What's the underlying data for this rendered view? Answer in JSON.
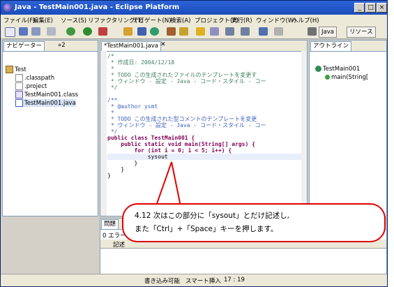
{
  "window": {
    "title": "Java - TestMain001.java - Eclipse Platform"
  },
  "window_buttons": [
    "_",
    "□",
    "×"
  ],
  "menu": [
    "ファイル(F)",
    "編集(E)",
    "ソース(S)",
    "リファクタリング(T)",
    "ナビゲート(N)",
    "検索(A)",
    "プロジェクト(P)",
    "実行(R)",
    "ウィンドウ(W)",
    "ヘルプ(H)"
  ],
  "perspectives": [
    "Java",
    "リソース"
  ],
  "navigator": {
    "tab": "ナビゲーター",
    "tab2": "»2",
    "project": "Test",
    "files": [
      ".classpath",
      ".project",
      "TestMain001.class",
      "TestMain001.java"
    ]
  },
  "editor": {
    "tab": "*TestMain001.java",
    "lines": [
      "/*",
      " * 作成日: 2004/12/18",
      " *",
      " * TODO この生成されたファイルのテンプレートを変更す",
      " * ウィンドウ - 設定 - Java - コード・スタイル - コー",
      " */",
      "",
      "/**",
      " * @author ysmt",
      " *",
      " * TODO この生成された型コメントのテンプレートを変更",
      " * ウィンドウ - 設定 - Java - コード・スタイル - コー",
      " */",
      "public class TestMain001 {",
      "    public static void main(String[] args) {",
      "        for (int i = 0; i < 5; i++) {",
      "            sysout",
      "        }",
      "    }",
      "}"
    ]
  },
  "outline": {
    "tab": "アウトライン",
    "class": "TestMain001",
    "method": "main(String["
  },
  "problems": {
    "tab": "問題",
    "summary": "0 エラー",
    "column": "記述"
  },
  "status": {
    "writable": "書き込み可能",
    "insert_mode": "スマート挿入",
    "position": "17 : 19"
  },
  "callout": {
    "line1": "4.12 次はこの部分に「sysout」とだけ記述し,",
    "line2": "また「Ctrl」+「Space」キーを押します。"
  }
}
